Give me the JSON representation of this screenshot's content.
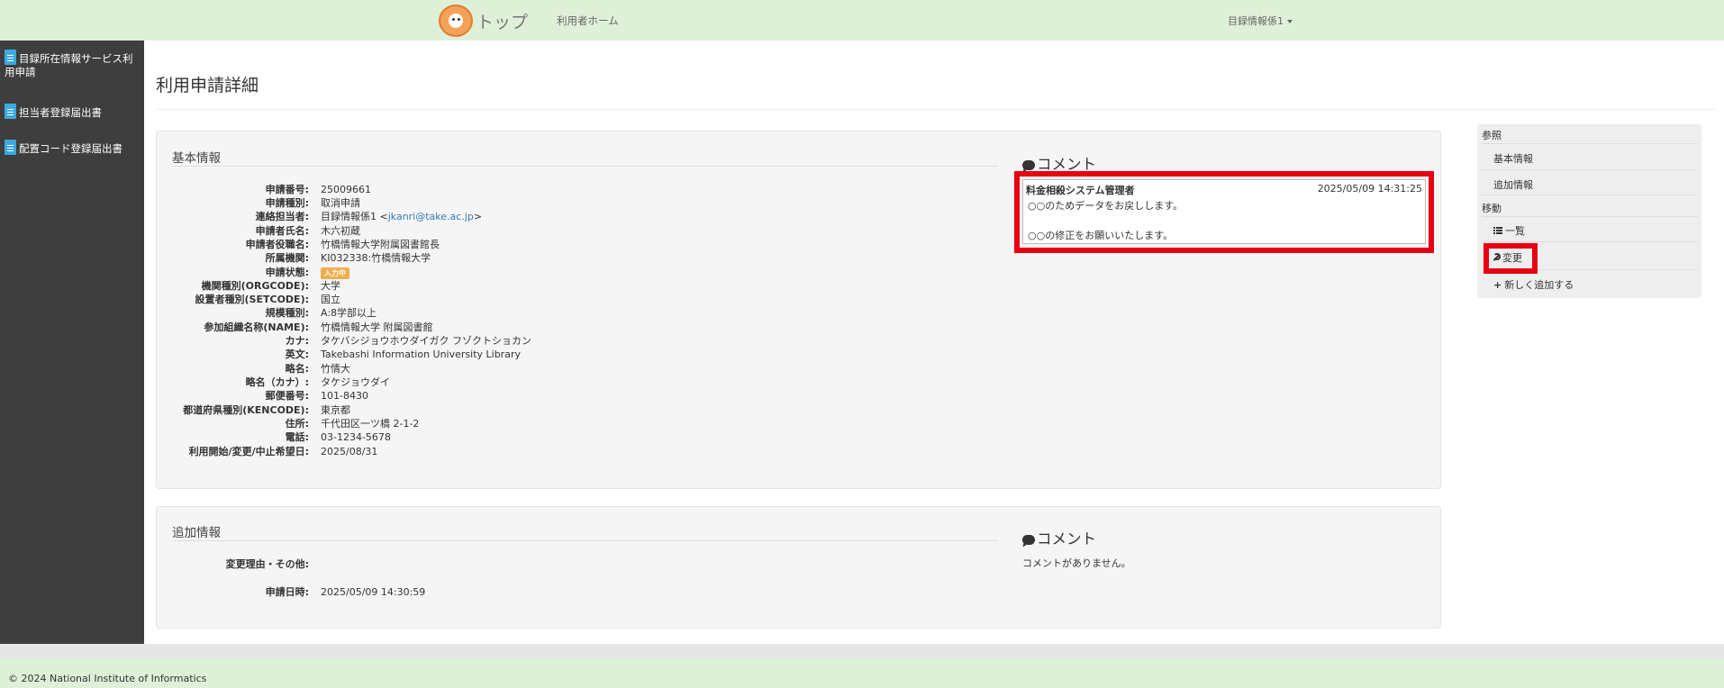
{
  "nav": {
    "brand_label": "トップ",
    "home_link": "利用者ホーム",
    "user_menu": "目録情報係1"
  },
  "sidebar": {
    "items": [
      {
        "label": "目録所在情報サービス利用申請",
        "icon": "document-icon"
      },
      {
        "label": "担当者登録届出書",
        "icon": "document-icon"
      },
      {
        "label": "配置コード登録届出書",
        "icon": "document-icon"
      }
    ]
  },
  "page": {
    "title": "利用申請詳細"
  },
  "basic_info": {
    "heading": "基本情報",
    "rows": [
      {
        "label": "申請番号:",
        "value": "25009661"
      },
      {
        "label": "申請種別:",
        "value": "取消申請"
      },
      {
        "label": "連絡担当者:",
        "value_prefix": "目録情報係1 <",
        "email": "jkanri@take.ac.jp",
        "value_suffix": ">"
      },
      {
        "label": "申請者氏名:",
        "value": "木六初蔵"
      },
      {
        "label": "申請者役職名:",
        "value": "竹橋情報大学附属図書館長"
      },
      {
        "label": "所属機関:",
        "value": "KI032338:竹橋情報大学"
      },
      {
        "label": "申請状態:",
        "badge": "入力中",
        "badge_color": "#f0ad4e"
      },
      {
        "label": "機関種別(ORGCODE):",
        "value": "大学"
      },
      {
        "label": "設置者種別(SETCODE):",
        "value": "国立"
      },
      {
        "label": "規模種別:",
        "value": "A:8学部以上"
      },
      {
        "label": "参加組織名称(NAME):",
        "value": "竹橋情報大学 附属図書館"
      },
      {
        "label": "カナ:",
        "value": "タケバシジョウホウダイガク フゾクトショカン"
      },
      {
        "label": "英文:",
        "value": "Takebashi Information University Library"
      },
      {
        "label": "略名:",
        "value": "竹情大"
      },
      {
        "label": "略名（カナ）:",
        "value": "タケジョウダイ"
      },
      {
        "label": "郵便番号:",
        "value": "101-8430"
      },
      {
        "label": "都道府県種別(KENCODE):",
        "value": "東京都"
      },
      {
        "label": "住所:",
        "value": "千代田区一ツ橋 2-1-2"
      },
      {
        "label": "電話:",
        "value": "03-1234-5678"
      },
      {
        "label": "利用開始/変更/中止希望日:",
        "value": "2025/08/31"
      }
    ],
    "comment_heading": "コメント",
    "comment": {
      "author": "料金相殺システム管理者",
      "timestamp": "2025/05/09 14:31:25",
      "line1": "○○のためデータをお戻しします。",
      "line2": "○○の修正をお願いいたします。"
    }
  },
  "additional_info": {
    "heading": "追加情報",
    "rows": [
      {
        "label": "変更理由・その他:",
        "value": ""
      },
      {
        "label": "申請日時:",
        "value": "2025/05/09 14:30:59"
      }
    ],
    "comment_heading": "コメント",
    "no_comment": "コメントがありません。"
  },
  "right_panel": {
    "reference_heading": "参照",
    "reference_items": [
      "基本情報",
      "追加情報"
    ],
    "move_heading": "移動",
    "list_label": "一覧",
    "edit_label": "変更",
    "add_label": "新しく追加する"
  },
  "colors": {
    "nav_bg": "#dff0d8",
    "sidebar_bg": "#3e3e3e",
    "highlight": "#e60012",
    "badge": "#f0ad4e",
    "link": "#337ab7"
  },
  "footer": {
    "copyright": "© 2024 National Institute of Informatics"
  }
}
